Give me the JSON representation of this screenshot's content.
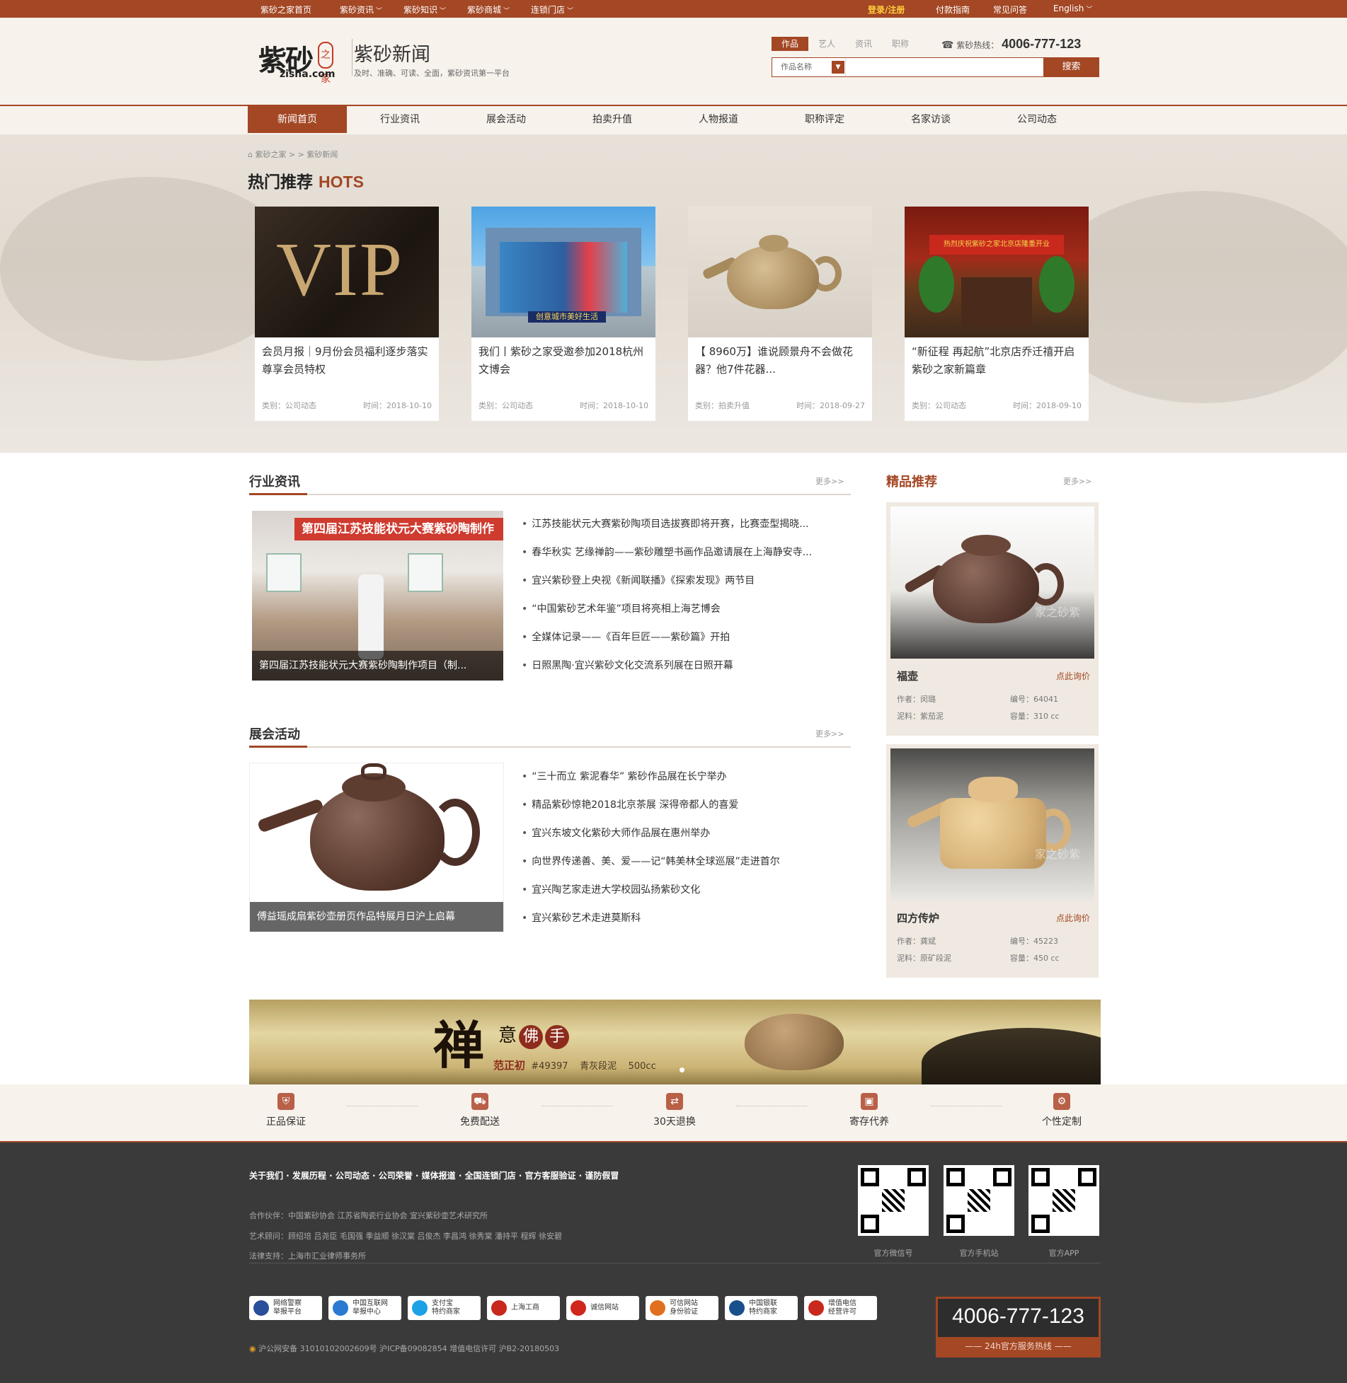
{
  "topbar": {
    "items": [
      "紫砂之家首页",
      "紫砂资讯",
      "紫砂知识",
      "紫砂商城",
      "连锁门店"
    ],
    "right": {
      "login": "登录/注册",
      "pay": "付款指南",
      "faq": "常见问答",
      "lang": "English"
    }
  },
  "header": {
    "logo_text": "紫砂",
    "logo_seal": "之家",
    "logo_domain": "zisha.com",
    "title": "紫砂新闻",
    "subtitle": "及时、准确、可读、全面，紫砂资讯第一平台",
    "search_tabs": [
      "作品",
      "艺人",
      "资讯",
      "职称"
    ],
    "hotline_label": "紫砂热线：",
    "hotline": "4006-777-123",
    "search_select": "作品名称",
    "search_button": "搜索"
  },
  "nav": [
    "新闻首页",
    "行业资讯",
    "展会活动",
    "拍卖升值",
    "人物报道",
    "职称评定",
    "名家访谈",
    "公司动态"
  ],
  "breadcrumb": "紫砂之家 > > 紫砂新闻",
  "hots": {
    "title": "热门推荐",
    "title_en": "HOTS",
    "vip_text": "VIP",
    "building_text": "创意城市美好生活",
    "store_sign": "热烈庆祝紫砂之家北京店隆重开业",
    "cards": [
      {
        "title": "会员月报｜9月份会员福利逐步落实 尊享会员特权",
        "category": "类别：公司动态",
        "time": "时间：2018-10-10"
      },
      {
        "title": "我们丨紫砂之家受邀参加2018杭州文博会",
        "category": "类别：公司动态",
        "time": "时间：2018-10-10"
      },
      {
        "title": "【 8960万】谁说顾景舟不会做花器？他7件花器...",
        "category": "类别：拍卖升值",
        "time": "时间：2018-09-27"
      },
      {
        "title": "“新征程 再起航”北京店乔迁禧开启紫砂之家新篇章",
        "category": "类别：公司动态",
        "time": "时间：2018-09-10"
      }
    ]
  },
  "industry": {
    "title": "行业资讯",
    "more": "更多>>",
    "photo_banner": "第四届江苏技能状元大赛紫砂陶制作",
    "caption": "第四届江苏技能状元大赛紫砂陶制作项目（制...",
    "items": [
      "江苏技能状元大赛紫砂陶项目选拔赛即将开赛，比赛壶型揭晓...",
      "春华秋实 艺缘禅韵——紫砂雕塑书画作品邀请展在上海静安寺...",
      "宜兴紫砂登上央视《新闻联播》《探索发现》两节目",
      "“中国紫砂艺术年鉴”项目将亮相上海艺博会",
      "全媒体记录——《百年巨匠——紫砂篇》开拍",
      "日照黑陶·宜兴紫砂文化交流系列展在日照开幕"
    ]
  },
  "expo": {
    "title": "展会活动",
    "more": "更多>>",
    "caption": "傅益瑶成扇紫砂壶册页作品特展月日沪上启幕",
    "items": [
      "“三十而立 紫泥春华” 紫砂作品展在长宁举办",
      "精品紫砂惊艳2018北京茶展 深得帝都人的喜爱",
      "宜兴东坡文化紫砂大师作品展在惠州举办",
      "向世界传递善、美、爱——记“韩美林全球巡展”走进首尔",
      "宜兴陶艺家走进大学校园弘扬紫砂文化",
      "宜兴紫砂艺术走进莫斯科"
    ]
  },
  "featured": {
    "title": "精品推荐",
    "more": "更多>>",
    "products": [
      {
        "name": "福壶",
        "ask": "点此询价",
        "author": "作者：闵璐",
        "code": "编号：64041",
        "clay": "泥料：紫茄泥",
        "capacity": "容量：310 cc",
        "watermark": "家之砂紫"
      },
      {
        "name": "四方传炉",
        "ask": "点此询价",
        "author": "作者：龚斌",
        "code": "编号：45223",
        "clay": "泥料：原矿段泥",
        "capacity": "容量：450 cc",
        "watermark": "家之砂紫"
      }
    ]
  },
  "ad_banner": {
    "big": "禅",
    "rest": [
      "意",
      "佛",
      "手"
    ],
    "artist": "范正初",
    "code": "#49397",
    "clay": "青灰段泥",
    "capacity": "500cc"
  },
  "services": [
    "正品保证",
    "免费配送",
    "30天退换",
    "寄存代养",
    "个性定制"
  ],
  "footer": {
    "links": "关于我们 · 发展历程 · 公司动态 · 公司荣誉 · 媒体报道 · 全国连锁门店 · 官方客服验证 · 谨防假冒",
    "partners": "合作伙伴：中国紫砂协会  江苏省陶瓷行业协会  宜兴紫砂壶艺术研究所",
    "advisors": "艺术顾问：顾绍培  吕尧臣  毛国强  季益顺  徐汉棠  吕俊杰  李昌鸿  徐秀棠  潘持平  程辉  徐安碧",
    "legal": "法律支持：上海市汇业律师事务所",
    "qrcodes": [
      "官方微信号",
      "官方手机站",
      "官方APP"
    ],
    "badges": [
      {
        "line1": "网络警察",
        "line2": "举报平台",
        "color": "#2a4f9a"
      },
      {
        "line1": "中国互联网",
        "line2": "举报中心",
        "color": "#2a7ad1"
      },
      {
        "line1": "支付宝",
        "line2": "特约商家",
        "color": "#1aa1e6"
      },
      {
        "line1": "上海工商",
        "line2": "",
        "color": "#c8281d"
      },
      {
        "line1": "诚信网站",
        "line2": "",
        "color": "#d0261b"
      },
      {
        "line1": "可信网站",
        "line2": "身份验证",
        "color": "#e0701f"
      },
      {
        "line1": "中国银联",
        "line2": "特约商家",
        "color": "#1a4f8e"
      },
      {
        "line1": "增值电信",
        "line2": "经营许可",
        "color": "#c9281d"
      }
    ],
    "icp": "沪公网安备 31010102002609号  沪ICP备09082854  增值电信许可 沪B2-20180503",
    "hotline": "4006-777-123",
    "hotline_label": "—— 24h官方服务热线 ——"
  }
}
